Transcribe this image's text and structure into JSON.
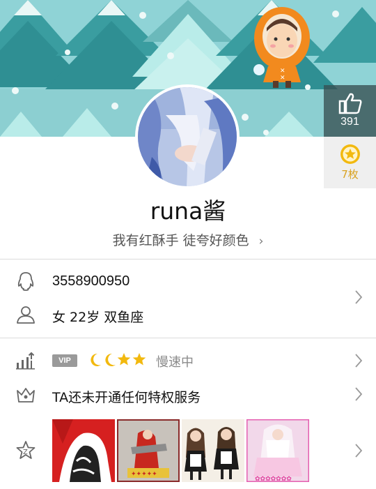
{
  "profile": {
    "nickname": "runa酱",
    "signature": "我有红酥手 徒夸好颜色",
    "like_count": "391",
    "medal_count": "7枚"
  },
  "info": {
    "qq_number": "3558900950",
    "basic": "女  22岁  双鱼座"
  },
  "vip": {
    "tag": "VIP",
    "status": "慢速中",
    "level_icons": [
      "moon-icon",
      "moon-icon",
      "star-icon",
      "star-icon"
    ]
  },
  "privilege": {
    "text": "TA还未开通任何特权服务"
  },
  "gallery": {
    "photos": [
      "photo-1",
      "photo-2",
      "photo-3",
      "photo-4"
    ]
  },
  "colors": {
    "banner": "#8fd3d6",
    "tree_dark": "#2f8f93",
    "tree_light": "#b9ece9",
    "gold": "#f2b90f"
  }
}
